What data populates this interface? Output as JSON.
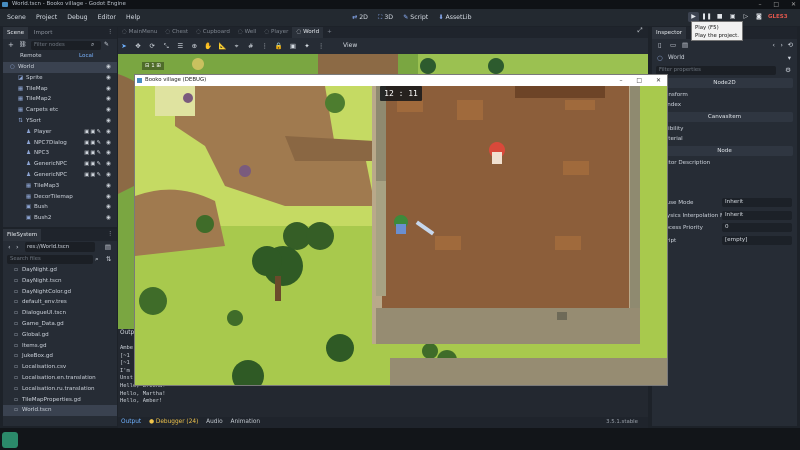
{
  "window": {
    "title": "World.tscn - Booko village - Godot Engine",
    "controls": [
      "–",
      "□",
      "✕"
    ]
  },
  "menubar": {
    "items": [
      "Scene",
      "Project",
      "Debug",
      "Editor",
      "Help"
    ]
  },
  "modes": [
    {
      "icon": "2d-icon",
      "glyph": "⇄",
      "label": "2D"
    },
    {
      "icon": "3d-icon",
      "glyph": "⛶",
      "label": "3D"
    },
    {
      "icon": "script-icon",
      "glyph": "✎",
      "label": "Script"
    },
    {
      "icon": "assetlib-icon",
      "glyph": "⬇",
      "label": "AssetLib"
    }
  ],
  "renderer": "GLES3",
  "tooltip": {
    "line1": "Play (F5)",
    "line2": "Play the project."
  },
  "scene_dock": {
    "tabs": [
      "Scene",
      "Import"
    ],
    "filter_placeholder": "Filter nodes",
    "remote": "Remote",
    "local": "Local",
    "nodes": [
      {
        "name": "World",
        "icon": "node2d-icon",
        "indent": 0
      },
      {
        "name": "Sprite",
        "icon": "sprite-icon",
        "indent": 1
      },
      {
        "name": "TileMap",
        "icon": "tilemap-icon",
        "indent": 1
      },
      {
        "name": "TileMap2",
        "icon": "tilemap-icon",
        "indent": 1
      },
      {
        "name": "Carpets etc",
        "icon": "tilemap-icon",
        "indent": 1
      },
      {
        "name": "YSort",
        "icon": "ysort-icon",
        "indent": 1
      },
      {
        "name": "Player",
        "icon": "kinematic-icon",
        "indent": 2
      },
      {
        "name": "NPC7Dialog",
        "icon": "kinematic-icon",
        "indent": 2
      },
      {
        "name": "NPC3",
        "icon": "kinematic-icon",
        "indent": 2
      },
      {
        "name": "GenericNPC",
        "icon": "kinematic-icon",
        "indent": 2
      },
      {
        "name": "GenericNPC",
        "icon": "kinematic-icon",
        "indent": 2
      },
      {
        "name": "TileMap3",
        "icon": "tilemap-icon",
        "indent": 2
      },
      {
        "name": "DecorTilemap",
        "icon": "tilemap-icon",
        "indent": 2
      },
      {
        "name": "Bush",
        "icon": "staticbody-icon",
        "indent": 2
      },
      {
        "name": "Bush2",
        "icon": "staticbody-icon",
        "indent": 2
      }
    ]
  },
  "filesystem": {
    "title": "FileSystem",
    "path": "res://World.tscn",
    "search_placeholder": "Search files",
    "files": [
      "DayNight.gd",
      "DayNight.tscn",
      "DayNightColor.gd",
      "default_env.tres",
      "DialogueUI.tscn",
      "Game_Data.gd",
      "Global.gd",
      "Items.gd",
      "JukeBox.gd",
      "Localisation.csv",
      "Localisation.en.translation",
      "Localisation.ru.translation",
      "TileMapProperties.gd",
      "World.tscn"
    ]
  },
  "editor_tabs": [
    "MainMenu",
    "Chest",
    "Cupboard",
    "Well",
    "Player",
    "World"
  ],
  "editor_toolbar": {
    "view_label": "View"
  },
  "viewport": {
    "zoom_label": "⊟ 1 ⊞"
  },
  "game": {
    "title": "Booko village (DEBUG)",
    "clock": "12 : 11"
  },
  "output": {
    "label": "Output",
    "lines": [
      "Ambe",
      "[~1",
      "[~1",
      "I'm",
      "",
      "Unst",
      "Hello, Briena!",
      "Hello, Martha!",
      "Hello, Amber!"
    ]
  },
  "bottom_tabs": [
    "Output",
    "Debugger (24)",
    "Audio",
    "Animation"
  ],
  "version": "3.5.1.stable",
  "inspector": {
    "title": "Inspector",
    "node_name": "World",
    "filter_placeholder": "Filter properties",
    "sections": [
      {
        "header": "Node2D"
      },
      {
        "row": "Transform"
      },
      {
        "row": "Z Index"
      },
      {
        "header": "CanvasItem"
      },
      {
        "row": "Visibility"
      },
      {
        "row": "Material"
      },
      {
        "header": "Node"
      },
      {
        "row": "Editor Description"
      }
    ],
    "props": [
      {
        "label": "Pause Mode",
        "value": "Inherit"
      },
      {
        "label": "Physics Interpolation M",
        "value": "Inherit"
      },
      {
        "label": "Process Priority",
        "value": "0"
      },
      {
        "label": "Script",
        "value": "[empty]"
      }
    ]
  }
}
